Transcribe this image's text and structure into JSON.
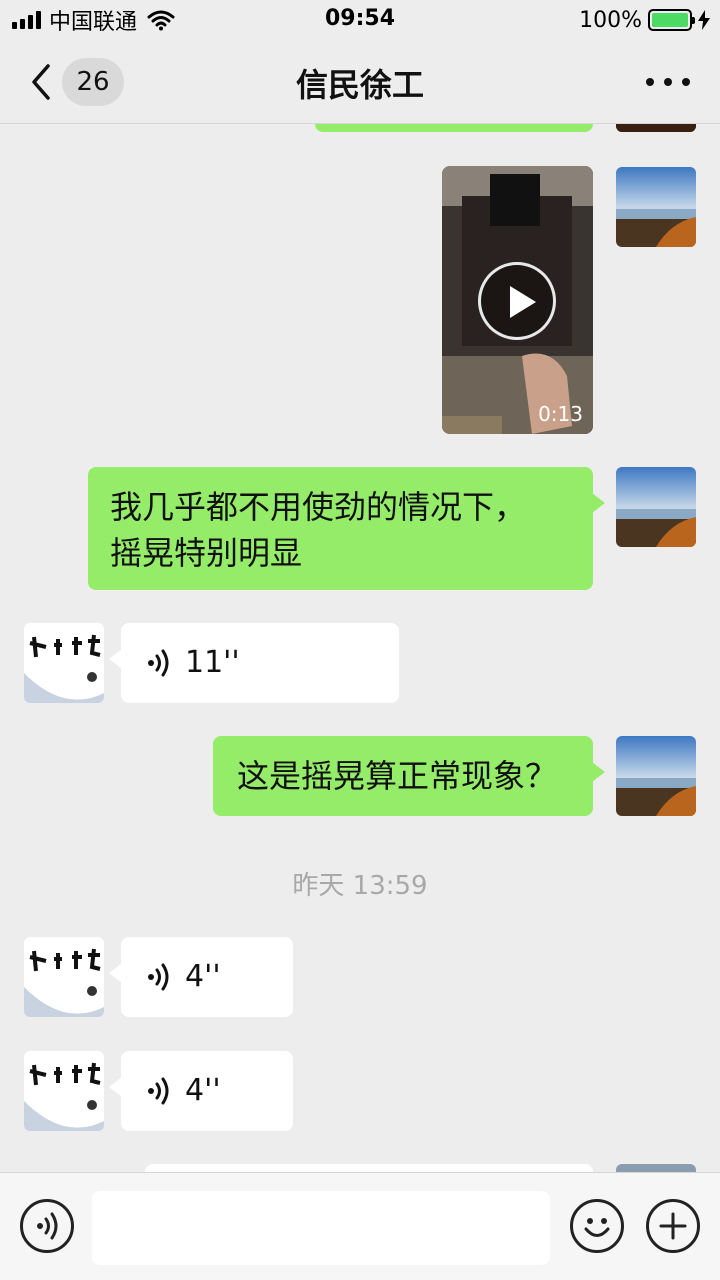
{
  "status_bar": {
    "carrier": "中国联通",
    "time": "09:54",
    "battery": "100%",
    "battery_level": 1.0,
    "icons": [
      "signal-icon",
      "wifi-icon",
      "battery-icon",
      "charging-icon"
    ]
  },
  "nav": {
    "unread_count": "26",
    "title": "信民徐工",
    "icons": [
      "back-icon",
      "more-icon"
    ]
  },
  "messages": [
    {
      "type": "text",
      "direction": "outgoing",
      "text": "我几乎都不用使劲的情况下，",
      "text2": "摇晃特别明显"
    },
    {
      "type": "voice",
      "direction": "incoming",
      "duration": "11''"
    },
    {
      "type": "text",
      "direction": "outgoing",
      "text": "这是摇晃算正常现象？"
    },
    {
      "type": "video",
      "direction": "outgoing",
      "duration": "0:13"
    },
    {
      "type": "voice",
      "direction": "incoming",
      "duration": "4''"
    },
    {
      "type": "voice",
      "direction": "incoming",
      "duration": "4''"
    }
  ],
  "timestamp": "昨天 13:59",
  "avatar_calligraphy": "天道酬勤",
  "input_bar": {
    "placeholder": "",
    "icons": [
      "voice-input-icon",
      "emoji-icon",
      "plus-icon"
    ]
  },
  "colors": {
    "background": "#ededed",
    "outgoing_bubble": "#95ec69",
    "incoming_bubble": "#ffffff",
    "timestamp_text": "#a8a8a8"
  }
}
